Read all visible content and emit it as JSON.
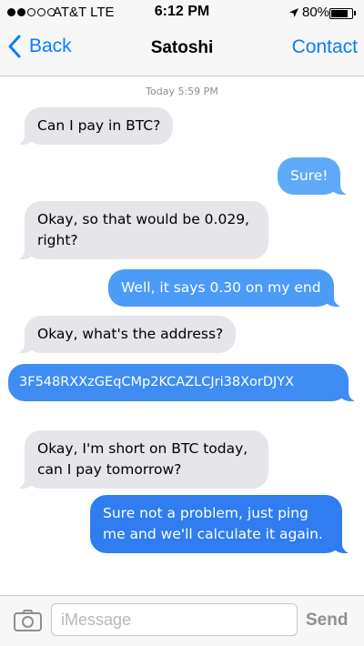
{
  "status_bar": {
    "carrier": "AT&T LTE",
    "time": "6:12 PM",
    "battery": "80%",
    "battery_level": 0.8,
    "signal_bars_filled": 2,
    "signal_bars_total": 5
  },
  "nav": {
    "back_label": "Back",
    "title": "Satoshi",
    "contact_label": "Contact",
    "accent_color": "#0a7cff"
  },
  "thread": {
    "timestamp": "Today 5:59 PM",
    "messages": [
      {
        "from": "them",
        "text": "Can I pay in BTC?"
      },
      {
        "from": "me",
        "text": "Sure!"
      },
      {
        "from": "them",
        "text": "Okay, so that would be 0.029, right?"
      },
      {
        "from": "me",
        "text": "Well, it says 0.30 on my end"
      },
      {
        "from": "them",
        "text": "Okay, what's the address?"
      },
      {
        "from": "me",
        "text": "3F548RXXzGEqCMp2KCAZLCJri38XorDJYX"
      },
      {
        "from": "them",
        "text": "Okay, I'm short on BTC today, can I pay tomorrow?"
      },
      {
        "from": "me",
        "text": "Sure not a problem, just ping me and we'll calculate it again."
      }
    ]
  },
  "composer": {
    "placeholder": "iMessage",
    "value": "",
    "send_label": "Send"
  },
  "icons": {
    "back": "chevron-left-icon",
    "location": "location-arrow-icon",
    "camera": "camera-icon"
  }
}
